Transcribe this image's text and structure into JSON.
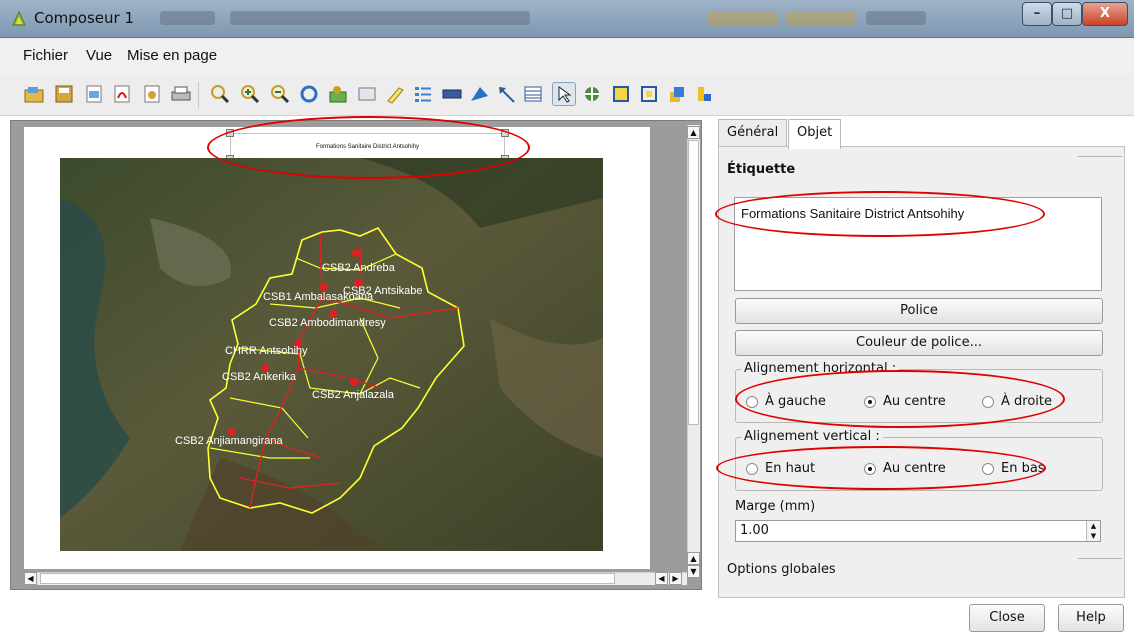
{
  "window": {
    "title": "Composeur 1",
    "controls": {
      "minimize": "–",
      "maximize": "□",
      "close": "X"
    }
  },
  "menu": {
    "items": [
      "Fichier",
      "Vue",
      "Mise en page"
    ]
  },
  "toolbar": {
    "icons": [
      "open-template-icon",
      "save-template-icon",
      "export-image-icon",
      "export-pdf-icon",
      "export-svg-icon",
      "print-icon",
      "zoom-full-icon",
      "zoom-in-icon",
      "zoom-out-icon",
      "refresh-icon",
      "add-map-icon",
      "add-image-icon",
      "add-label-icon",
      "add-legend-icon",
      "add-scalebar-icon",
      "add-shape-icon",
      "add-arrow-icon",
      "add-table-icon",
      "select-move-icon",
      "move-content-icon",
      "group-icon",
      "ungroup-icon",
      "raise-items-icon",
      "align-icon"
    ]
  },
  "canvas": {
    "label_text": "Formations Sanitaire District Antsohihy",
    "map_places": [
      "CSB2 Andreba",
      "CSB1 Ambalasakoana",
      "CSB2 Antsikabe",
      "CSB2 Ambodimandresy",
      "CHRR Antsohihy",
      "CSB2 Ankerika",
      "CSB2 Anjalazala",
      "CSB2 Anjiamangirana"
    ]
  },
  "panel": {
    "tabs": [
      "Général",
      "Objet"
    ],
    "active_tab": "Objet",
    "section_title": "Étiquette",
    "label_value": "Formations Sanitaire District Antsohihy",
    "font_button": "Police",
    "font_color_button": "Couleur de police...",
    "halign": {
      "title": "Alignement horizontal :",
      "options": [
        "À gauche",
        "Au centre",
        "À droite"
      ],
      "selected": "Au centre"
    },
    "valign": {
      "title": "Alignement vertical :",
      "options": [
        "En haut",
        "Au centre",
        "En bas"
      ],
      "selected": "Au centre"
    },
    "margin_label": "Marge (mm)",
    "margin_value": "1.00",
    "global_options": "Options globales"
  },
  "footer": {
    "close": "Close",
    "help": "Help"
  },
  "colors": {
    "highlight": "#e00000",
    "map_boundary": "#ffff33",
    "roads": "#dd2222"
  }
}
